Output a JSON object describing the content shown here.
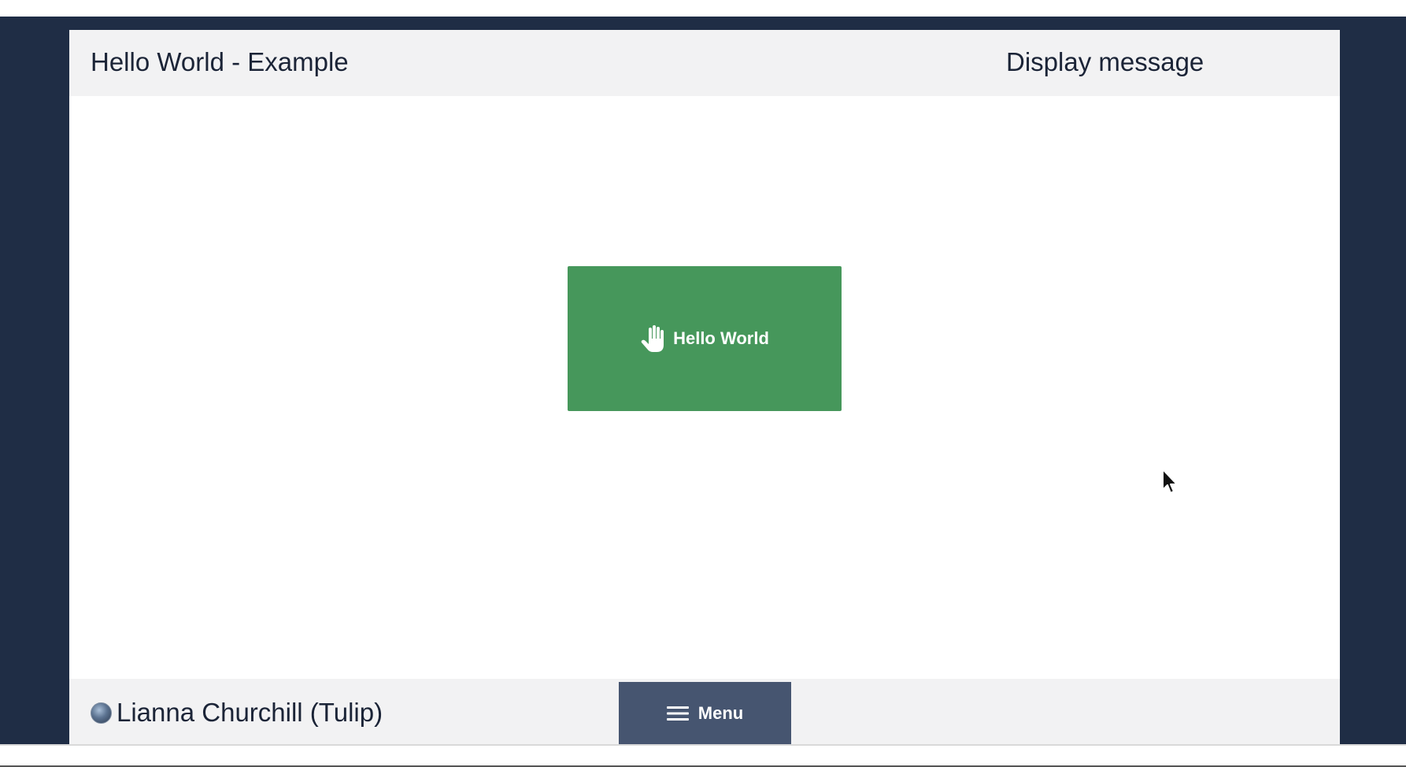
{
  "header": {
    "app_title": "Hello World - Example",
    "display_message": "Display message"
  },
  "canvas": {
    "hello_button": {
      "label": "Hello World",
      "icon": "hand-icon",
      "color": "#46975b"
    }
  },
  "footer": {
    "user_name": "Lianna Churchill (Tulip)",
    "avatar": "avatar",
    "menu_button": {
      "label": "Menu",
      "icon": "hamburger-icon",
      "color": "#465570"
    }
  },
  "colors": {
    "backdrop": "#1f2d45",
    "bar": "#f2f2f3",
    "text": "#1b2437"
  }
}
